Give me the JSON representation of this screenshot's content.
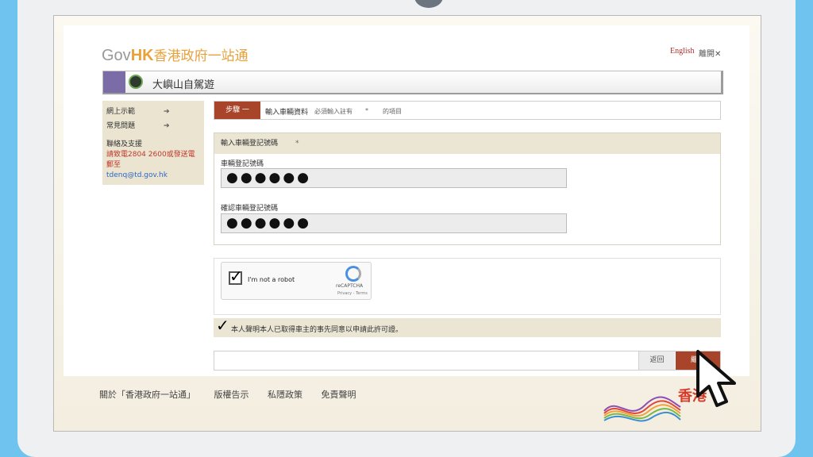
{
  "header": {
    "logo_gov": "Gov",
    "logo_hk": "HK",
    "logo_cn": "香港政府一站通",
    "lang_link": "English",
    "leave_link": "離開✕"
  },
  "title_bar": {
    "title": "大嶼山自駕遊",
    "icon": "traffic-light-icon"
  },
  "sidebar": {
    "items": [
      {
        "label": "網上示範",
        "arrow": "➔"
      },
      {
        "label": "常見問題",
        "arrow": "➔"
      }
    ],
    "contact_heading": "聯絡及支援",
    "contact_text": "請致電2804 2600或發送電郵至",
    "contact_email": "tdenq@td.gov.hk"
  },
  "step_bar": {
    "step_label": "步驟 一",
    "step_title": "輸入車輛資料",
    "required_note": "必須輸入註有",
    "required_star": "*",
    "required_note2": "的項目"
  },
  "form": {
    "section_title": "輸入車輛登記號碼",
    "section_star": "*",
    "field1_label": "車輛登記號碼",
    "field1_value": "●●●●●●",
    "field2_label": "確認車輛登記號碼",
    "field2_value": "●●●●●●"
  },
  "recaptcha": {
    "checked": true,
    "label": "I'm not a robot",
    "brand": "reCAPTCHA",
    "terms": "Privacy - Terms"
  },
  "declaration": {
    "checked": true,
    "text": "本人聲明本人已取得車主的事先同意以申請此許可證。"
  },
  "actions": {
    "back_label": "返回",
    "next_label": "繼續"
  },
  "footer": {
    "links": [
      "關於「香港政府一站通」",
      "版權告示",
      "私隱政策",
      "免責聲明"
    ],
    "brand": "香港"
  },
  "colors": {
    "accent": "#a8442a",
    "brand_orange": "#e7a23c",
    "panel_beige": "#ebe6d4",
    "title_purple": "#7b6ca8"
  }
}
